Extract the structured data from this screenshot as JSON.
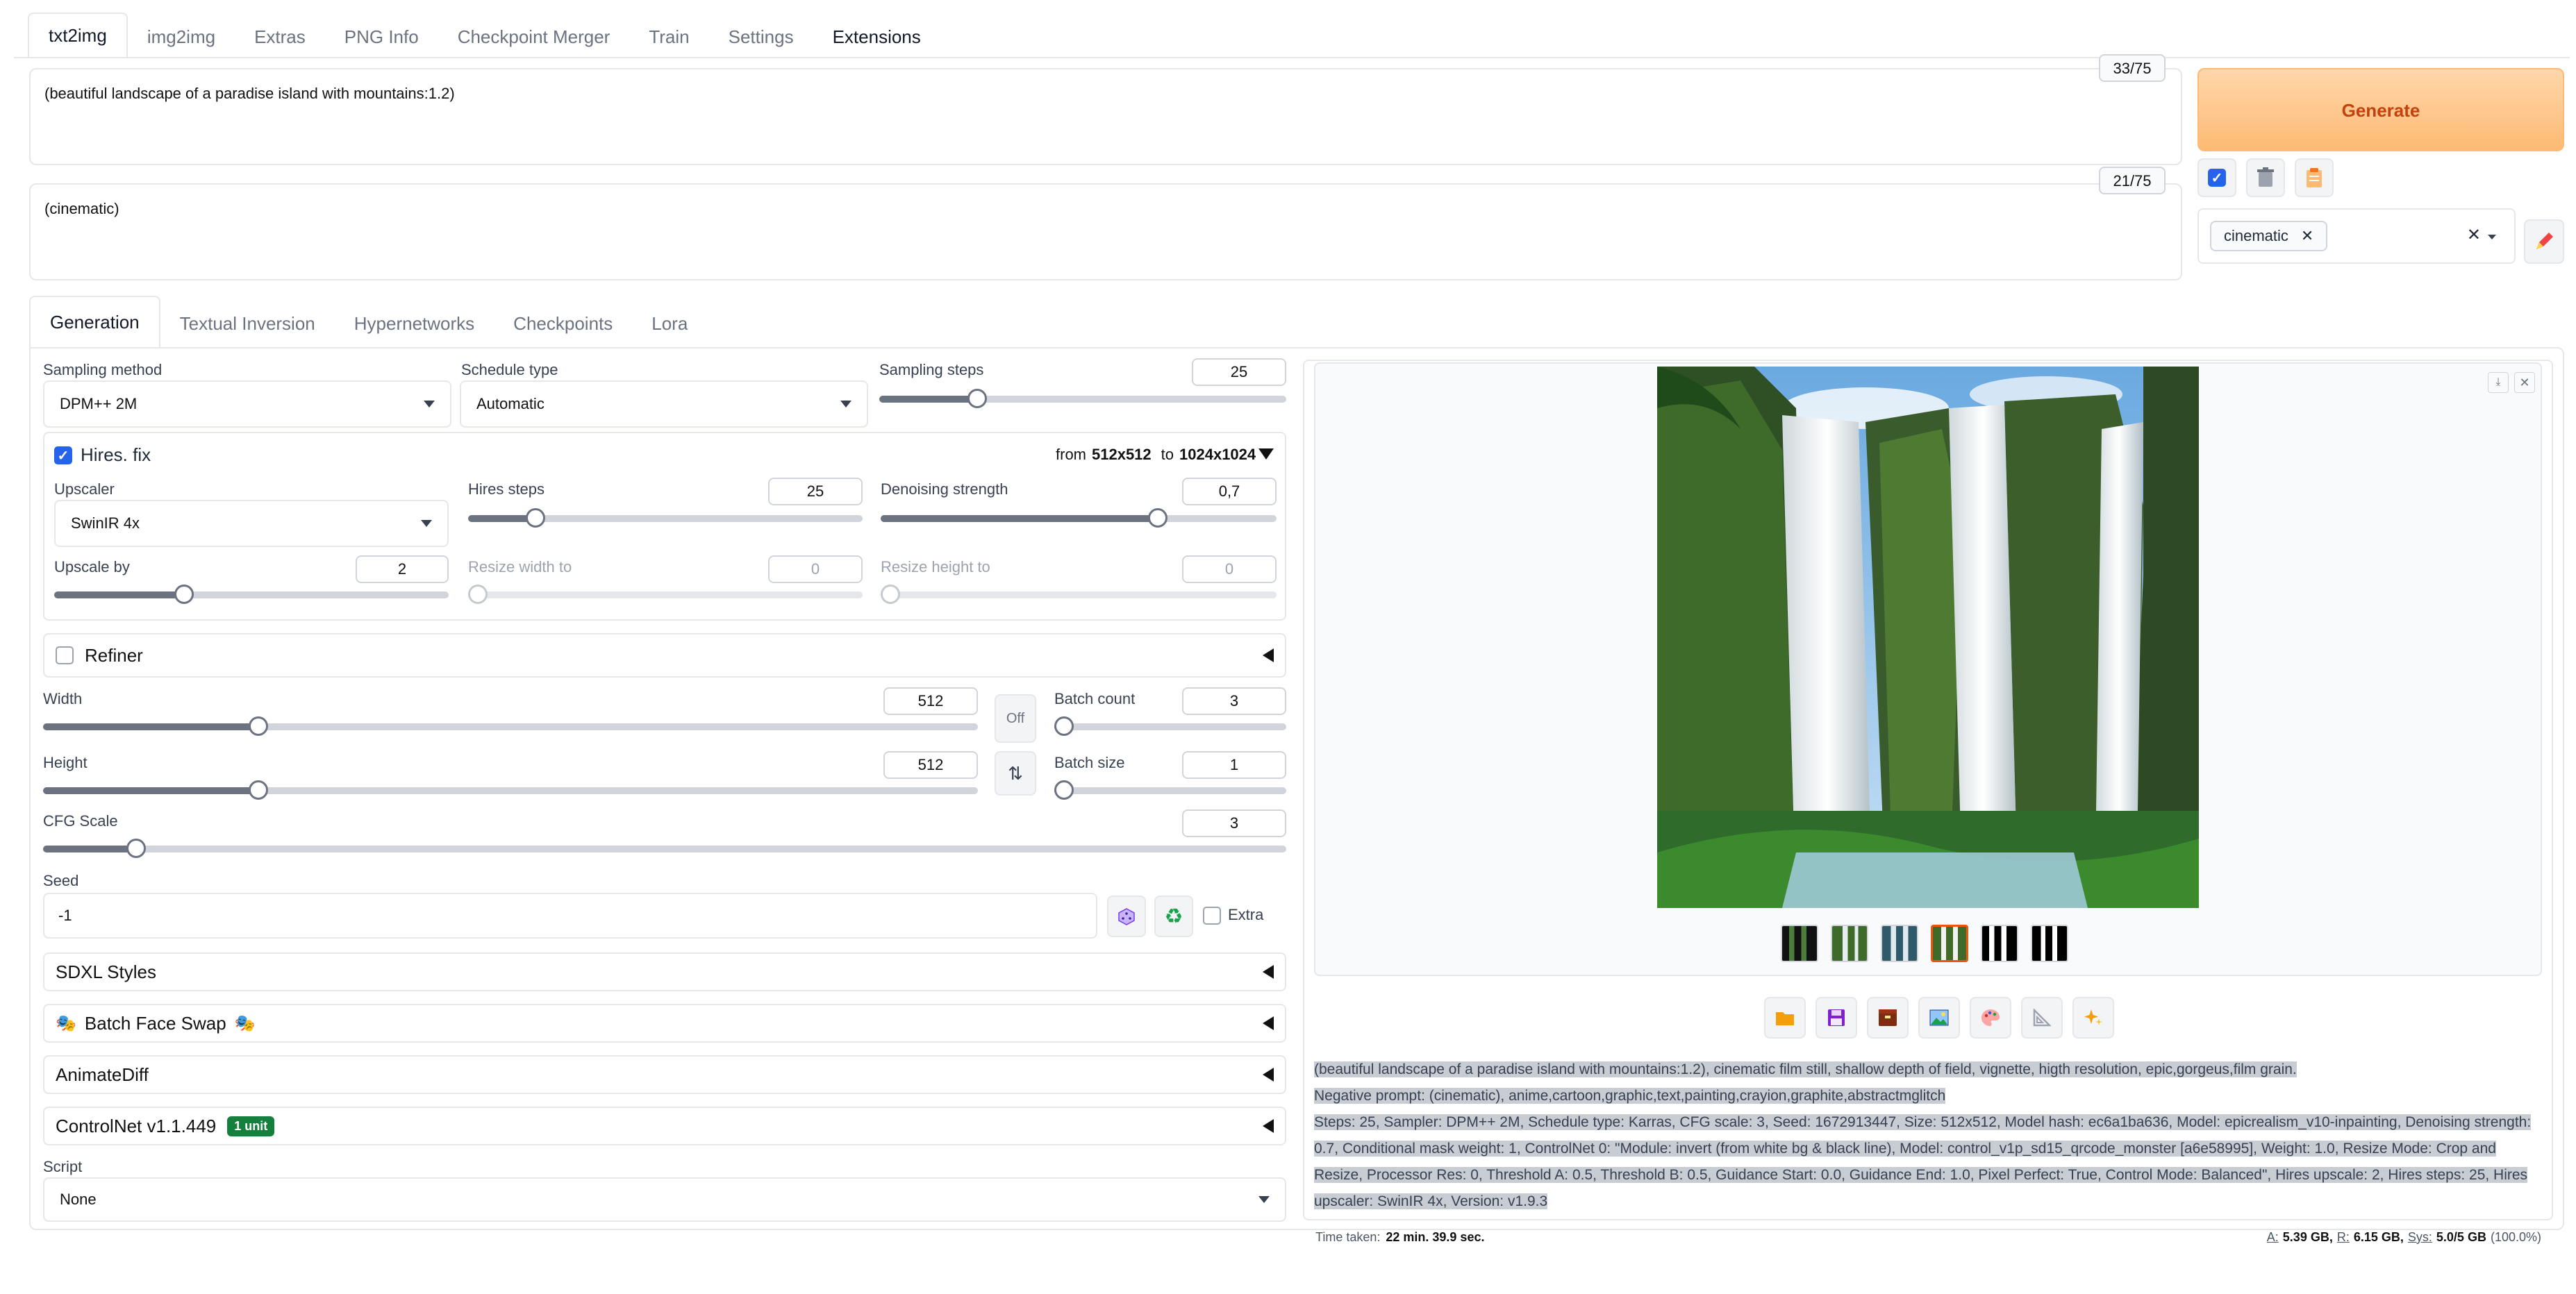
{
  "tabs": [
    {
      "label": "txt2img",
      "active": true
    },
    {
      "label": "img2img"
    },
    {
      "label": "Extras"
    },
    {
      "label": "PNG Info"
    },
    {
      "label": "Checkpoint Merger"
    },
    {
      "label": "Train"
    },
    {
      "label": "Settings"
    },
    {
      "label": "Extensions"
    }
  ],
  "prompt": {
    "text": "(beautiful landscape of a paradise island with mountains:1.2)",
    "counter": "33/75"
  },
  "negative_prompt": {
    "text": "(cinematic)",
    "counter": "21/75"
  },
  "generate_label": "Generate",
  "style_chip": "cinematic",
  "subtabs": [
    "Generation",
    "Textual Inversion",
    "Hypernetworks",
    "Checkpoints",
    "Lora"
  ],
  "sampling": {
    "method_label": "Sampling method",
    "method": "DPM++ 2M",
    "schedule_label": "Schedule type",
    "schedule": "Automatic",
    "steps_label": "Sampling steps",
    "steps": "25",
    "steps_level": 0.24
  },
  "hires": {
    "label": "Hires. fix",
    "checked": true,
    "from_prefix": "from",
    "from": "512x512",
    "to_prefix": "to",
    "to": "1024x1024",
    "upscaler_label": "Upscaler",
    "upscaler": "SwinIR 4x",
    "steps_label": "Hires steps",
    "steps": "25",
    "steps_level": 0.17,
    "denoise_label": "Denoising strength",
    "denoise": "0,7",
    "denoise_level": 0.7,
    "upscale_by_label": "Upscale by",
    "upscale_by": "2",
    "upscale_by_level": 0.33,
    "resize_w_label": "Resize width to",
    "resize_w": "0",
    "resize_h_label": "Resize height to",
    "resize_h": "0"
  },
  "refiner_label": "Refiner",
  "size": {
    "width_label": "Width",
    "width": "512",
    "width_level": 0.23,
    "height_label": "Height",
    "height": "512",
    "height_level": 0.23,
    "off_label": "Off",
    "batch_count_label": "Batch count",
    "batch_count": "3",
    "batch_count_level": 0.02,
    "batch_size_label": "Batch size",
    "batch_size": "1",
    "batch_size_level": 0.0
  },
  "cfg": {
    "label": "CFG Scale",
    "value": "3",
    "level": 0.075
  },
  "seed": {
    "label": "Seed",
    "value": "-1",
    "extra_label": "Extra"
  },
  "accordions": {
    "sdxl": "SDXL Styles",
    "faceswap": "Batch Face Swap",
    "animatediff": "AnimateDiff",
    "controlnet": "ControlNet v1.1.449",
    "controlnet_badge": "1 unit"
  },
  "script": {
    "label": "Script",
    "value": "None"
  },
  "info": {
    "line1": "(beautiful landscape of a paradise island with mountains:1.2), cinematic film still, shallow depth of field, vignette, higth resolution, epic,gorgeus,film grain.",
    "line2": "Negative prompt: (cinematic), anime,cartoon,graphic,text,painting,crayion,graphite,abstractmglitch",
    "line3": "Steps: 25, Sampler: DPM++ 2M, Schedule type: Karras, CFG scale: 3, Seed: 1672913447, Size: 512x512, Model hash: ec6a1ba636, Model: epicrealism_v10-inpainting, Denoising strength:",
    "line4": "0.7, Conditional mask weight: 1, ControlNet 0: \"Module: invert (from white bg & black line), Model: control_v1p_sd15_qrcode_monster [a6e58995], Weight: 1.0, Resize Mode: Crop and",
    "line5": "Resize, Processor Res: 0, Threshold A: 0.5, Threshold B: 0.5, Guidance Start: 0.0, Guidance End: 1.0, Pixel Perfect: True, Control Mode: Balanced\", Hires upscale: 2, Hires steps: 25, Hires",
    "line6": "upscaler: SwinIR 4x, Version: v1.9.3"
  },
  "time_label": "Time taken:",
  "time_value": "22 min. 39.9 sec.",
  "mem": {
    "a_label": "A:",
    "a": "5.39 GB,",
    "r_label": "R:",
    "r": "6.15 GB,",
    "sys_label": "Sys:",
    "sys": "5.0/5 GB",
    "pct": "(100.0%)"
  },
  "colors": {
    "accent": "#ea580c",
    "check": "#2563eb",
    "badge": "#15803d"
  }
}
